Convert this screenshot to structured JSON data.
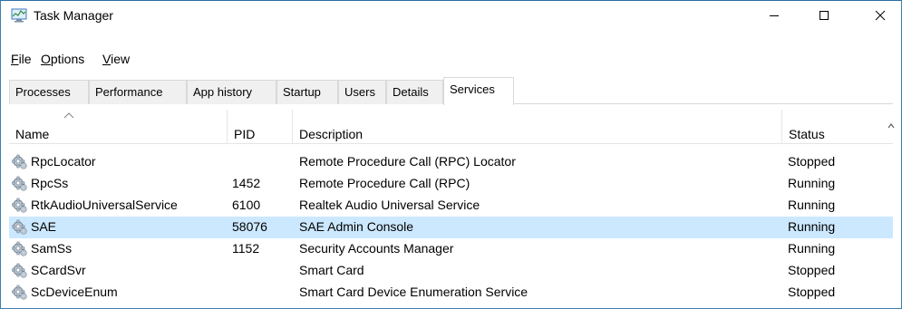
{
  "window": {
    "title": "Task Manager"
  },
  "menu": [
    {
      "key": "F",
      "rest": "ile"
    },
    {
      "key": "O",
      "rest": "ptions"
    },
    {
      "key": "V",
      "rest": "iew"
    }
  ],
  "tabs": [
    "Processes",
    "Performance",
    "App history",
    "Startup",
    "Users",
    "Details",
    "Services"
  ],
  "active_tab": "Services",
  "columns": {
    "name": "Name",
    "pid": "PID",
    "description": "Description",
    "status": "Status"
  },
  "rows": [
    {
      "name": "RpcLocator",
      "pid": "",
      "description": "Remote Procedure Call (RPC) Locator",
      "status": "Stopped"
    },
    {
      "name": "RpcSs",
      "pid": "1452",
      "description": "Remote Procedure Call (RPC)",
      "status": "Running"
    },
    {
      "name": "RtkAudioUniversalService",
      "pid": "6100",
      "description": "Realtek Audio Universal Service",
      "status": "Running"
    },
    {
      "name": "SAE",
      "pid": "58076",
      "description": "SAE Admin Console",
      "status": "Running",
      "selected": true
    },
    {
      "name": "SamSs",
      "pid": "1152",
      "description": "Security Accounts Manager",
      "status": "Running"
    },
    {
      "name": "SCardSvr",
      "pid": "",
      "description": "Smart Card",
      "status": "Stopped"
    },
    {
      "name": "ScDeviceEnum",
      "pid": "",
      "description": "Smart Card Device Enumeration Service",
      "status": "Stopped"
    }
  ],
  "colors": {
    "selected_row": "#cce8ff",
    "window_border": "#3c7fb1"
  }
}
